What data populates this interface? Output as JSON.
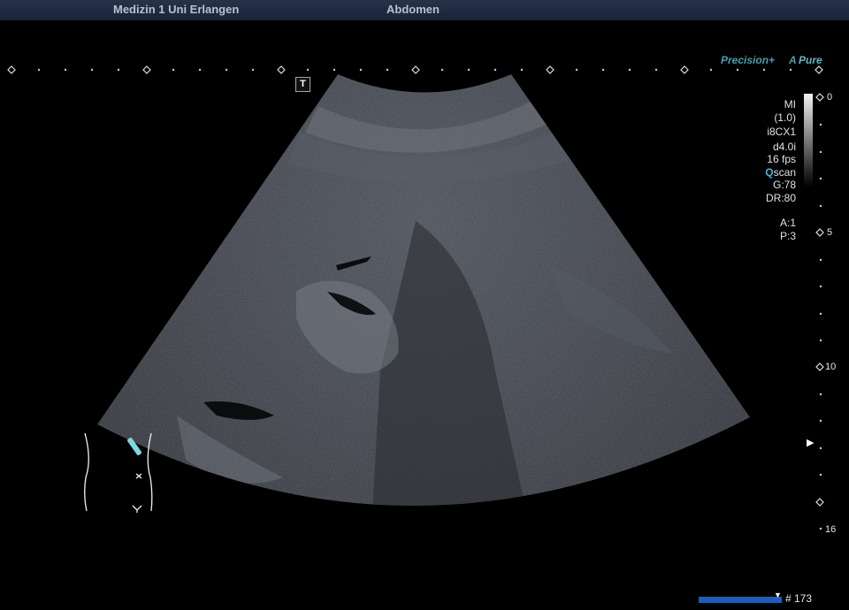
{
  "header": {
    "institution": "Medizin 1 Uni Erlangen",
    "exam": "Abdomen"
  },
  "brand": {
    "precision": "Precision+",
    "pure_mark": "A",
    "pure": "Pure"
  },
  "marker": "T",
  "params": {
    "mi_label": "MI",
    "mi_value": "(1.0)",
    "transducer": "i8CX1",
    "depth_setting": "d4.0i",
    "frame_rate": "16 fps",
    "qscan_q": "Q",
    "qscan_rest": "scan",
    "gain": "G:78",
    "dynamic_range": "DR:80",
    "a": "A:1",
    "p": "P:3"
  },
  "depth_scale": {
    "labels": [
      "0",
      "5",
      "10",
      "16"
    ]
  },
  "frame": {
    "count_label": "# 173",
    "marker": "▼"
  },
  "colors": {
    "header_text": "#b7c0d4",
    "accent": "#3fa1b0",
    "frame_bar": "#1a5fbf",
    "probe_marker": "#7fd6dc"
  }
}
